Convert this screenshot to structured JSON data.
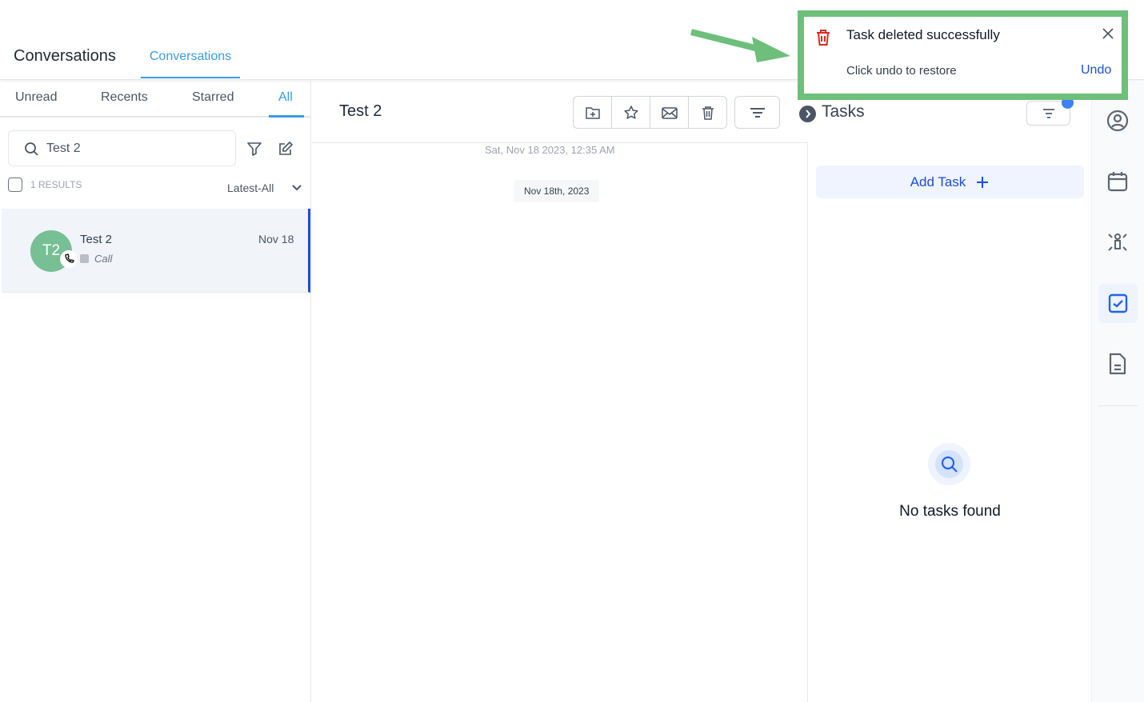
{
  "header": {
    "title": "Conversations",
    "tab": "Conversations"
  },
  "filters": {
    "tabs": [
      "Unread",
      "Recents",
      "Starred",
      "All"
    ],
    "active": "All"
  },
  "search": {
    "value": "Test 2"
  },
  "results": {
    "count_label": "1 RESULTS",
    "sort": "Latest-All"
  },
  "conversations": [
    {
      "initials": "T2",
      "name": "Test 2",
      "date": "Nov 18",
      "last_type": "Call"
    }
  ],
  "thread": {
    "title": "Test 2",
    "timestamp": "Sat, Nov 18 2023, 12:35 AM",
    "date_chip": "Nov 18th, 2023"
  },
  "tasks": {
    "title": "Tasks",
    "add_label": "Add Task",
    "empty": "No tasks found"
  },
  "toast": {
    "title": "Task deleted successfully",
    "message": "Click undo to restore",
    "action": "Undo",
    "accent": "#6dbf7a"
  },
  "colors": {
    "accent": "#1d4ed8",
    "tab_blue": "#3b9be0",
    "avatar": "#77bf95",
    "danger": "#dc2626"
  }
}
